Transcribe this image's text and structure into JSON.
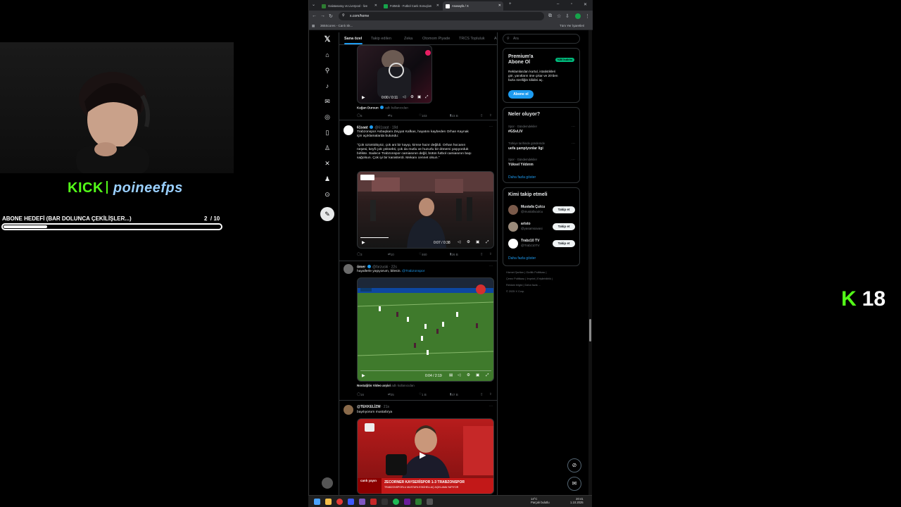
{
  "stream": {
    "kick_brand": "KICK",
    "streamer": "poineefps",
    "goal_label": "ABONE HEDEFİ (BAR DOLUNCA ÇEKİLİŞLER...)",
    "goal_current": "2",
    "goal_total": "/ 10",
    "goal_progress": 0.2,
    "viewer_count": "18"
  },
  "browser": {
    "tabs": [
      {
        "label": "Galatasaray vs Liverpool - live"
      },
      {
        "label": "FotMob - Futbol Canlı Sonuçları"
      },
      {
        "label": "Anasayfa / X"
      }
    ],
    "url": "x.com/home",
    "bookmark": "365Scores - Canlı Sk...",
    "all_bookmarks": "Tüm Yer İşaretleri"
  },
  "feed_tabs": {
    "t1": "Sana özel",
    "t2": "Takip edilen",
    "t3": "Zeka",
    "t4": "Otomom Piyade",
    "t5": "TRCS Topluluk",
    "t6": "A"
  },
  "tweet0": {
    "video_time": "0:00 / 0:11",
    "credit_name": "Kağan Dursun",
    "credit_suffix": "adlı kullanıcıdan",
    "replies": "6",
    "reposts": "4",
    "likes": "103",
    "views": "23 B"
  },
  "tweet1": {
    "name": "61saat",
    "handle": "@61saat · 19d",
    "line1": "Trabzonspor Asbaşkanı Zeyyat Kafkas, hayatını kaybeden Orhan Kaynak",
    "line2": "için açıklamalarda bulundu:",
    "quote1": "\"Çok üzüntülüyüz, çok ani bir kayıp, kimse hazır değildi. Orhan hocanın",
    "quote2": "neşesi, keyfi çok yüksekti, çok da mutlu ve huzurlu bir dönemi yaşıyorduk",
    "quote3": "birlikte. Sadece Trabzonspor camiasının değil, bütün futbol camiasının başı",
    "quote4": "sağolsun. Çok iyi bir karakterdi. Mekanı cennet olsun.\"",
    "video_time": "0:07 / 0:38",
    "replies": "3",
    "reposts": "10",
    "likes": "460",
    "views": "26 B"
  },
  "tweet2": {
    "name": "ömer",
    "handle": "@farzuski · 22s",
    "text": "hayallerle yaşıyorum, bilesin.",
    "mention": "@Trabzonspor",
    "video_time": "0:04 / 2:19",
    "credit_name": "Nostaljitis Video arşivi",
    "credit_suffix": "adlı kullanıcıdan",
    "replies": "16",
    "reposts": "25",
    "likes": "1 B",
    "views": "47 B"
  },
  "tweet3": {
    "name": "@TEKKELİZM",
    "handle": "· 21s",
    "text": "bayılıyorum mustafa'ya",
    "banner": "ZECORNER KAYSERİSPOR 1-3 TRABZONSPOR",
    "sub_banner": "TRABZONSPORLU MUSTAFA ESKİHELLAÇ AÇIKLAMA YAPIYOR",
    "live": "canlı yayın"
  },
  "right": {
    "search_placeholder": "Ara",
    "premium_title1": "Premium'a",
    "premium_title2": "Abone Ol",
    "premium_badge": "%50 İndirim",
    "premium_l1": "Reklamlardan kurtul, istatistikleri",
    "premium_l2": "gör, yanıtların öne çıkar ve 20'den",
    "premium_l3": "fazla özelliğin kilidini aç.",
    "premium_btn": "Abone ol",
    "trends_title": "Neler oluyor?",
    "trends": [
      {
        "cat": "Spor · Gündemdekiler",
        "name": "#GSvLIV"
      },
      {
        "cat": "Türkiye tarihinde gündemde",
        "name": "uefa şampiyonlar ligi"
      },
      {
        "cat": "Spor · Gündemdekiler",
        "name": "Yüksel Yıldırım"
      }
    ],
    "show_more": "Daha fazla göster",
    "who_title": "Kimi takip etmeli",
    "who": [
      {
        "name": "Mustafa Çulcu",
        "handle": "@mustafaculcu"
      },
      {
        "name": "aristo",
        "handle": "@yasamsavasi"
      },
      {
        "name": "Trabz10 TV",
        "handle": "@Trabz10TV"
      }
    ],
    "follow_label": "Takip et",
    "footer1": "Hizmet Şartları  |  Gizlilik Politikası  |",
    "footer2": "Çerez Politikası  |  İmprint  |  Erişilebilirlik  |",
    "footer3": "Reklam bilgisi  |  Daha fazla ...",
    "footer4": "© 2025 X Corp."
  },
  "taskbar": {
    "weather": "14°C",
    "weather_desc": "Parçalı bulutlu",
    "time": "20:41",
    "date": "1.10.2025"
  },
  "colors": {
    "kick_green": "#53fc18",
    "x_blue": "#1d9bf0",
    "bg": "#000000"
  }
}
